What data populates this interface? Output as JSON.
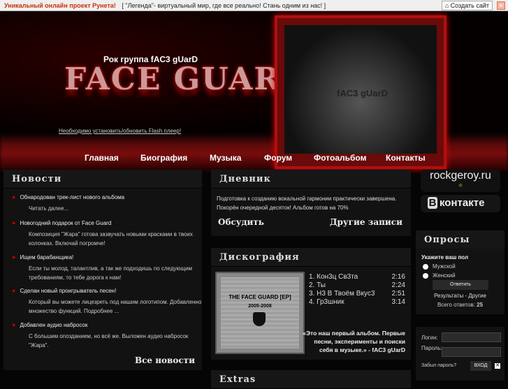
{
  "topbar": {
    "promo": "Уникальный онлайн проект Рунета!",
    "message": "[ \"Легенда\"- виртуальный мир, где все реально! Стань одним из нас! ]",
    "create_site": "Создать сайт",
    "close": "✕"
  },
  "header": {
    "band_title": "Рок группа fAC3 gUarD",
    "logo": "FACE GUARD",
    "flash_notice": "Необходимо установить/обновить Flash плеер!",
    "photo_text": "fAC3 gUarD"
  },
  "nav": [
    "Главная",
    "Биография",
    "Музыка",
    "Форум",
    "Фотоальбом",
    "Контакты"
  ],
  "news": {
    "title": "Новости",
    "items": [
      {
        "title": "Обнародован трек-лист нового альбома",
        "body": "Читать далее..."
      },
      {
        "title": "Новогодний подарок от Face Guard",
        "body": "Композиция \"Жара\" готова зазвучать новыми красками в твоих колонках. Включай погромче!"
      },
      {
        "title": "Ищем барабанщика!",
        "body": "Если ты молод, талантлив, а так же подходишь по следующим требованиям, то тебе дорога к нам!"
      },
      {
        "title": "Сделан новый проигрыватель песен!",
        "body": "Который вы можете лицезреть под нашим логотипом. Добавленно множество функций. Подробнее ..."
      },
      {
        "title": "Добавлен аудио набросок",
        "body": "С большим опозданием, но всё же. Выложен аудио набросок \"Жара\"."
      }
    ],
    "all_link": "Все новости"
  },
  "diary": {
    "title": "Дневник",
    "text": "Подготовка к созданию вокальной гармонии практически завершена. Покорён очередной десяток! Альбом готов на 70%",
    "discuss": "Обсудить",
    "other": "Другие записи"
  },
  "disco": {
    "title": "Дискография",
    "cover_title": "THE FACE GUARD [EP]",
    "cover_years": "2005-2008",
    "tracks": [
      {
        "name": "1. Кон3ц Св3та",
        "time": "2:16"
      },
      {
        "name": "2. Ты",
        "time": "2:24"
      },
      {
        "name": "3. Н3 В Твоём Вкус3",
        "time": "2:51"
      },
      {
        "name": "4. Гр3шник",
        "time": "3:14"
      }
    ],
    "quote": "«Это наш первый альбом. Первые песни, эксперименты и поиски себя в музыке.» - fAC3 gUarD"
  },
  "extras": {
    "title": "Extras"
  },
  "links": {
    "rockgeroy": "rockgeroy.ru",
    "vk_b": "В",
    "vk": "контакте"
  },
  "poll": {
    "title": "Опросы",
    "question": "Укажите ваш пол",
    "options": [
      "Мужской",
      "Женский"
    ],
    "answer": "Ответить",
    "results": "Результаты - Другие",
    "total_label": "Всего ответов:",
    "total": "25"
  },
  "login": {
    "login_label": "Логин:",
    "password_label": "Пароль:",
    "forgot": "Забыл пароль?",
    "enter": "ВХОД",
    "close": "✕"
  }
}
